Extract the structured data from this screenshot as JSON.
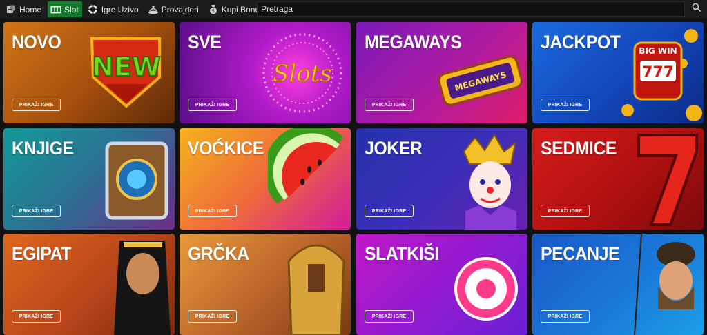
{
  "nav": {
    "items": [
      {
        "label": "Home",
        "icon": "home-icon"
      },
      {
        "label": "Slot",
        "icon": "slot-machine-icon",
        "active": true
      },
      {
        "label": "Igre Uzivo",
        "icon": "live-chip-icon"
      },
      {
        "label": "Provajderi",
        "icon": "provider-icon"
      },
      {
        "label": "Kupi Bonus",
        "icon": "bonus-bag-icon"
      }
    ],
    "active_color": "#177a2e"
  },
  "search": {
    "placeholder": "Pretraga",
    "icon": "search-icon"
  },
  "categories": [
    {
      "title": "NOVO",
      "button": "PRIKAŽI IGRE",
      "art": "NEW",
      "color_from": "#c96a10",
      "color_to": "#5c2a06"
    },
    {
      "title": "SVE",
      "button": "PRIKAŽI IGRE",
      "art": "Slots",
      "color_from": "#b21cc4",
      "color_to": "#5a0f8a"
    },
    {
      "title": "MEGAWAYS",
      "button": "PRIKAŽI IGRE",
      "art": "MEGAWAYS",
      "color_from": "#9a1ab8",
      "color_to": "#e01d6a"
    },
    {
      "title": "JACKPOT",
      "button": "PRIKAŽI IGRE",
      "art": "BIG WIN",
      "color_from": "#1a5fd6",
      "color_to": "#0b2c8a"
    },
    {
      "title": "KNJIGE",
      "button": "PRIKAŽI IGRE",
      "color_from": "#1aa5a0",
      "color_to": "#7a2f8f"
    },
    {
      "title": "VOĆKICE",
      "button": "PRIKAŽI IGRE",
      "color_from": "#f1a61d",
      "color_to": "#d2199a"
    },
    {
      "title": "JOKER",
      "button": "PRIKAŽI IGRE",
      "color_from": "#2a2ea8",
      "color_to": "#6a1fb0"
    },
    {
      "title": "SEDMICE",
      "button": "PRIKAŽI IGRE",
      "color_from": "#d71a1a",
      "color_to": "#7a0a0a"
    },
    {
      "title": "EGIPAT",
      "button": "PRIKAŽI IGRE",
      "color_from": "#d9531a",
      "color_to": "#7a2a0d"
    },
    {
      "title": "GRČKA",
      "button": "PRIKAŽI IGRE",
      "color_from": "#e08a2a",
      "color_to": "#7a3a12"
    },
    {
      "title": "SLATKIŠI",
      "button": "PRIKAŽI IGRE",
      "color_from": "#c217c9",
      "color_to": "#6a1fd6"
    },
    {
      "title": "PECANJE",
      "button": "PRIKAŽI IGRE",
      "color_from": "#1a5fcf",
      "color_to": "#1aa0e8"
    }
  ]
}
